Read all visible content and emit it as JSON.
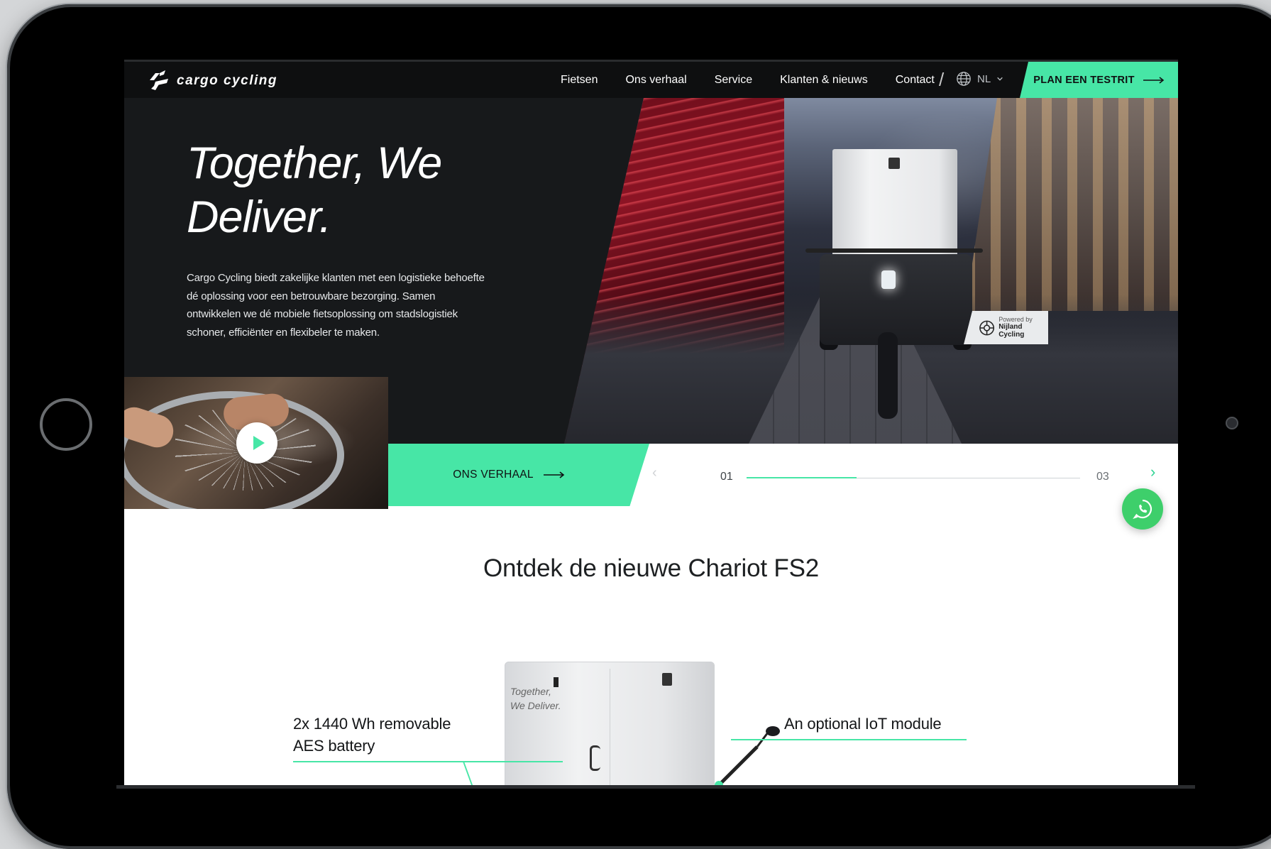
{
  "nav": {
    "logo_text": "cargo cycling",
    "links": [
      "Fietsen",
      "Ons verhaal",
      "Service",
      "Klanten & nieuws",
      "Contact"
    ],
    "separator": "/",
    "language": "NL",
    "cta_label": "PLAN EEN TESTRIT"
  },
  "hero": {
    "title": "Together, We Deliver.",
    "description": "Cargo Cycling biedt zakelijke klanten met een logistieke behoefte dé oplossing voor een betrouwbare bezorging. Samen ontwikkelen we dé mobiele fietsoplossing om stadslogistiek schoner, efficiënter en flexibeler te maken.",
    "badge": {
      "line1": "Powered by",
      "line2": "Nijland Cycling"
    },
    "box_text": "Together, We Deliver.",
    "story_button": "ONS VERHAAL",
    "slider": {
      "current": "01",
      "total": "03",
      "progress": 0.33
    }
  },
  "product": {
    "section_title": "Ontdek de nieuwe Chariot FS2",
    "box_label": "Together,\nWe Deliver.",
    "feature_left": "2x 1440 Wh removable AES battery",
    "feature_right": "An optional IoT module"
  },
  "colors": {
    "accent": "#47e6a6",
    "nav_bg": "#0e0f10",
    "hero_bg": "#17191b",
    "whatsapp": "#3ecf6b"
  },
  "icons": [
    "logo-mark-icon",
    "globe-icon",
    "chevron-down-icon",
    "arrow-right-icon",
    "play-icon",
    "chevron-left-icon",
    "chevron-right-icon",
    "whatsapp-icon",
    "nijland-logo-icon"
  ]
}
